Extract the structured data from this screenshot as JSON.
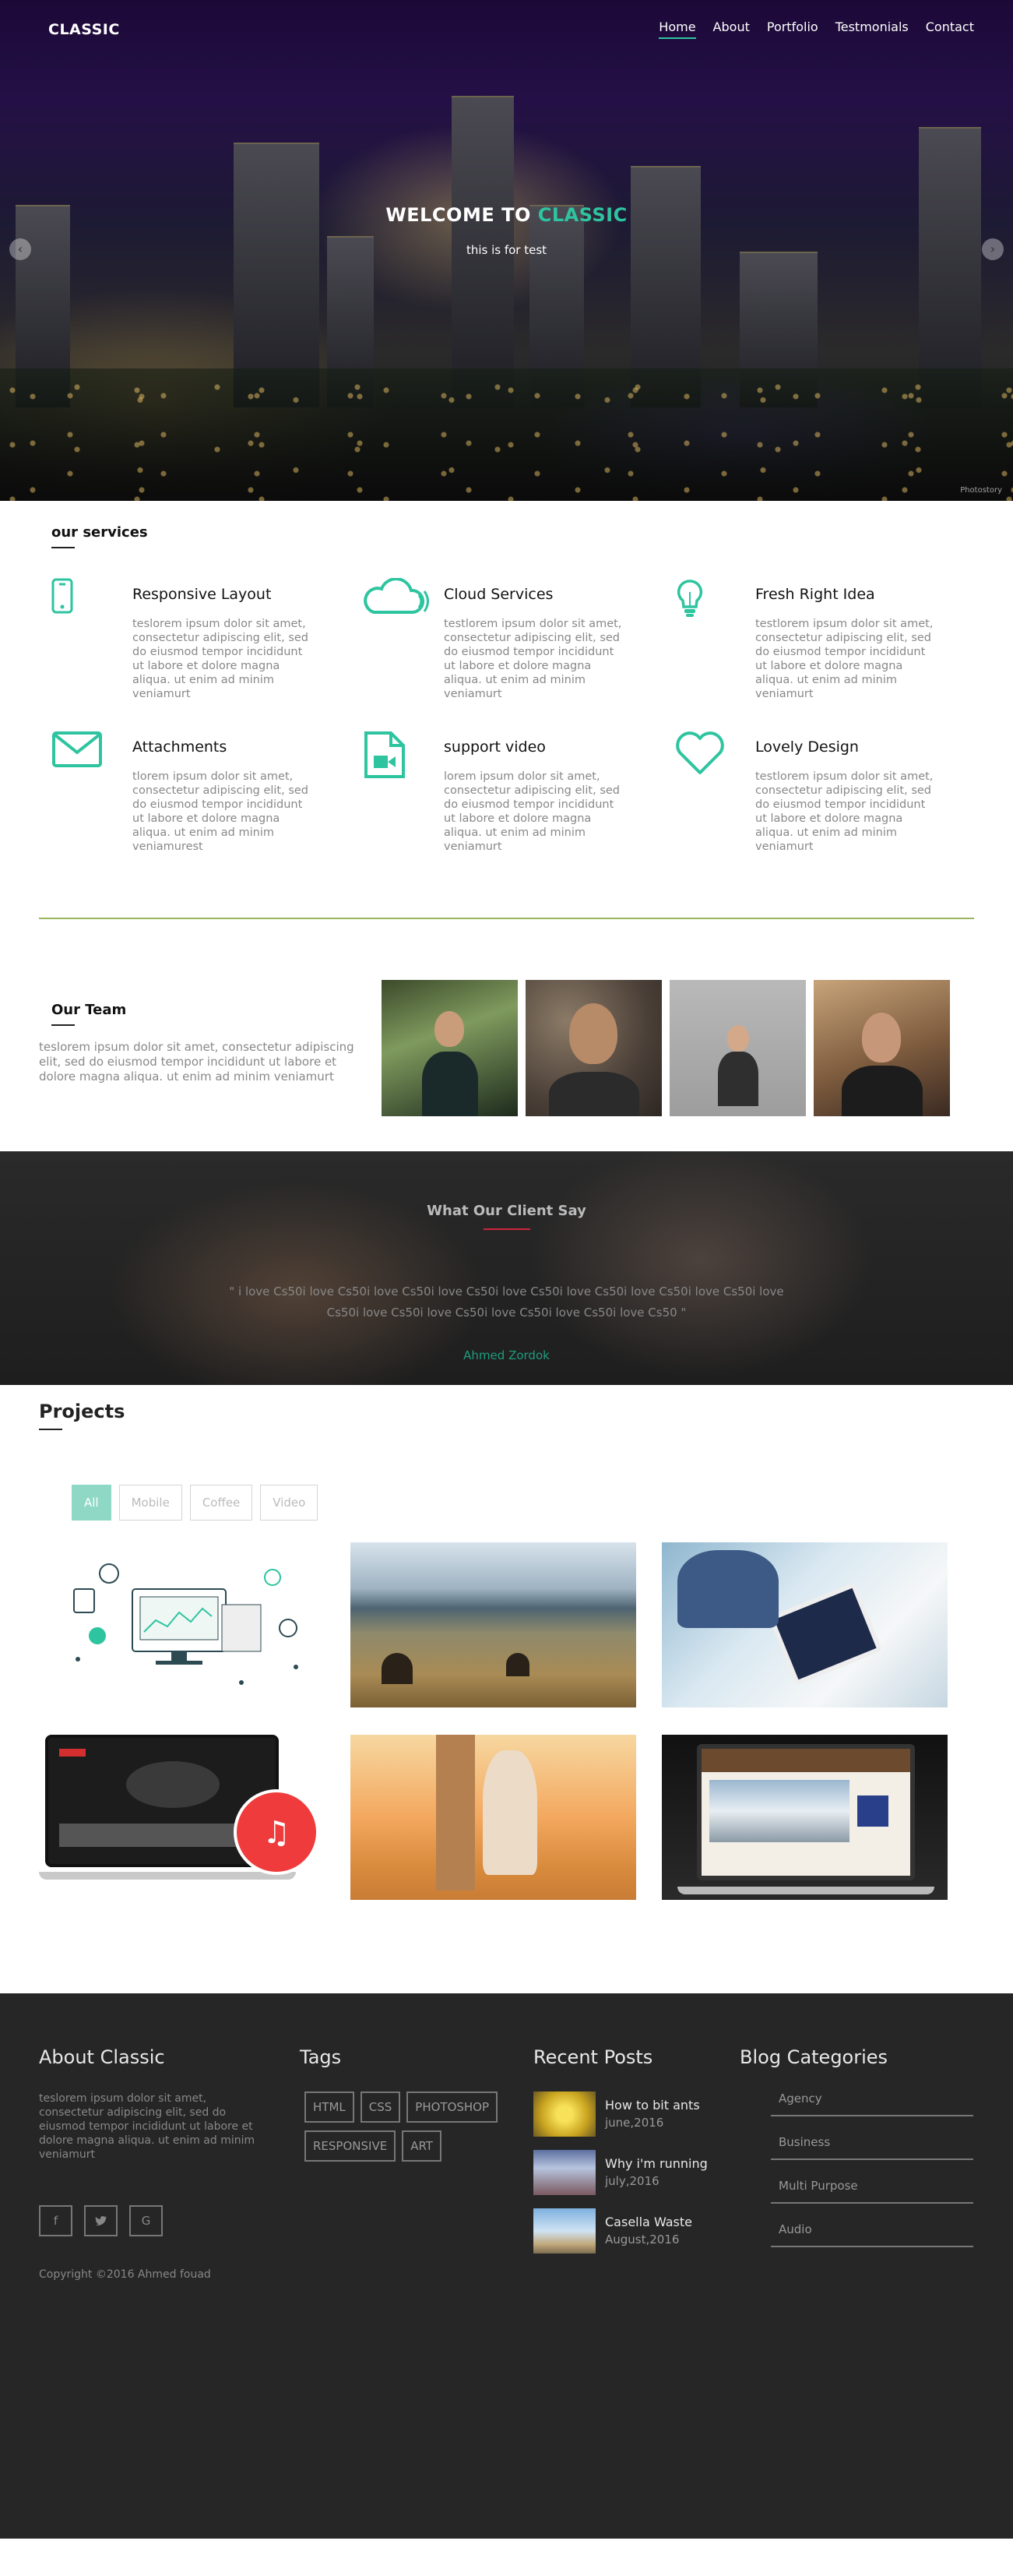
{
  "nav": {
    "logo": "CLASSIC",
    "items": [
      "Home",
      "About",
      "Portfolio",
      "Testmonials",
      "Contact"
    ]
  },
  "hero": {
    "title_prefix": "WELCOME TO ",
    "title_accent": "CLASSIC",
    "subtitle": "this is for test",
    "prev_arrow": "‹",
    "next_arrow": "›",
    "watermark": "Photostory"
  },
  "services": {
    "title": "our services",
    "items": [
      {
        "icon": "mobile-icon",
        "title": "Responsive Layout",
        "text": "teslorem ipsum dolor sit amet, consectetur adipiscing elit, sed do eiusmod tempor incididunt ut labore et dolore magna aliqua. ut enim ad minim veniamurt"
      },
      {
        "icon": "cloud-icon",
        "title": "Cloud Services",
        "text": "testlorem ipsum dolor sit amet, consectetur adipiscing elit, sed do eiusmod tempor incididunt ut labore et dolore magna aliqua. ut enim ad minim veniamurt"
      },
      {
        "icon": "lightbulb-icon",
        "title": "Fresh Right Idea",
        "text": "testlorem ipsum dolor sit amet, consectetur adipiscing elit, sed do eiusmod tempor incididunt ut labore et dolore magna aliqua. ut enim ad minim veniamurt"
      },
      {
        "icon": "envelope-icon",
        "title": "Attachments",
        "text": "tlorem ipsum dolor sit amet, consectetur adipiscing elit, sed do eiusmod tempor incididunt ut labore et dolore magna aliqua. ut enim ad minim veniamurest"
      },
      {
        "icon": "video-file-icon",
        "title": "support video",
        "text": "lorem ipsum dolor sit amet, consectetur adipiscing elit, sed do eiusmod tempor incididunt ut labore et dolore magna aliqua. ut enim ad minim veniamurt"
      },
      {
        "icon": "heart-icon",
        "title": "Lovely Design",
        "text": "testlorem ipsum dolor sit amet, consectetur adipiscing elit, sed do eiusmod tempor incididunt ut labore et dolore magna aliqua. ut enim ad minim veniamurt"
      }
    ]
  },
  "team": {
    "title": "Our Team",
    "text": "teslorem ipsum dolor sit amet, consectetur adipiscing elit, sed do eiusmod tempor incididunt ut labore et dolore magna aliqua. ut enim ad minim veniamurt"
  },
  "testimonial": {
    "title": "What Our Client Say",
    "quote": "\" i love Cs50i love Cs50i love Cs50i love Cs50i love Cs50i love Cs50i love Cs50i love Cs50i love Cs50i love Cs50i love Cs50i love Cs50i love Cs50i love Cs50 \"",
    "author": "Ahmed Zordok"
  },
  "projects": {
    "title": "Projects",
    "filters": [
      "All",
      "Mobile",
      "Coffee",
      "Video"
    ],
    "active_filter": "All"
  },
  "footer": {
    "about": {
      "title": "About Classic",
      "text": "teslorem ipsum dolor sit amet, consectetur adipiscing elit, sed do eiusmod tempor incididunt ut labore et dolore magna aliqua. ut enim ad minim veniamurt"
    },
    "socials": [
      "facebook-icon",
      "twitter-icon",
      "google-plus-icon"
    ],
    "copyright": "Copyright ©2016 Ahmed fouad",
    "tags": {
      "title": "Tags",
      "items": [
        "HTML",
        "CSS",
        "PHOTOSHOP",
        "RESPONSIVE",
        "ART"
      ]
    },
    "posts": {
      "title": "Recent Posts",
      "items": [
        {
          "title": "How to bit ants",
          "date": "june,2016"
        },
        {
          "title": "Why i'm running",
          "date": "july,2016"
        },
        {
          "title": "Casella Waste",
          "date": "August,2016"
        }
      ]
    },
    "categories": {
      "title": "Blog Categories",
      "items": [
        "Agency",
        "Business",
        "Multi Purpose",
        "Audio"
      ]
    }
  },
  "colors": {
    "accent": "#2ec4a0",
    "divider": "#9ab55e",
    "testimonial_bar": "#d0243b",
    "footer_bg": "#262626"
  }
}
